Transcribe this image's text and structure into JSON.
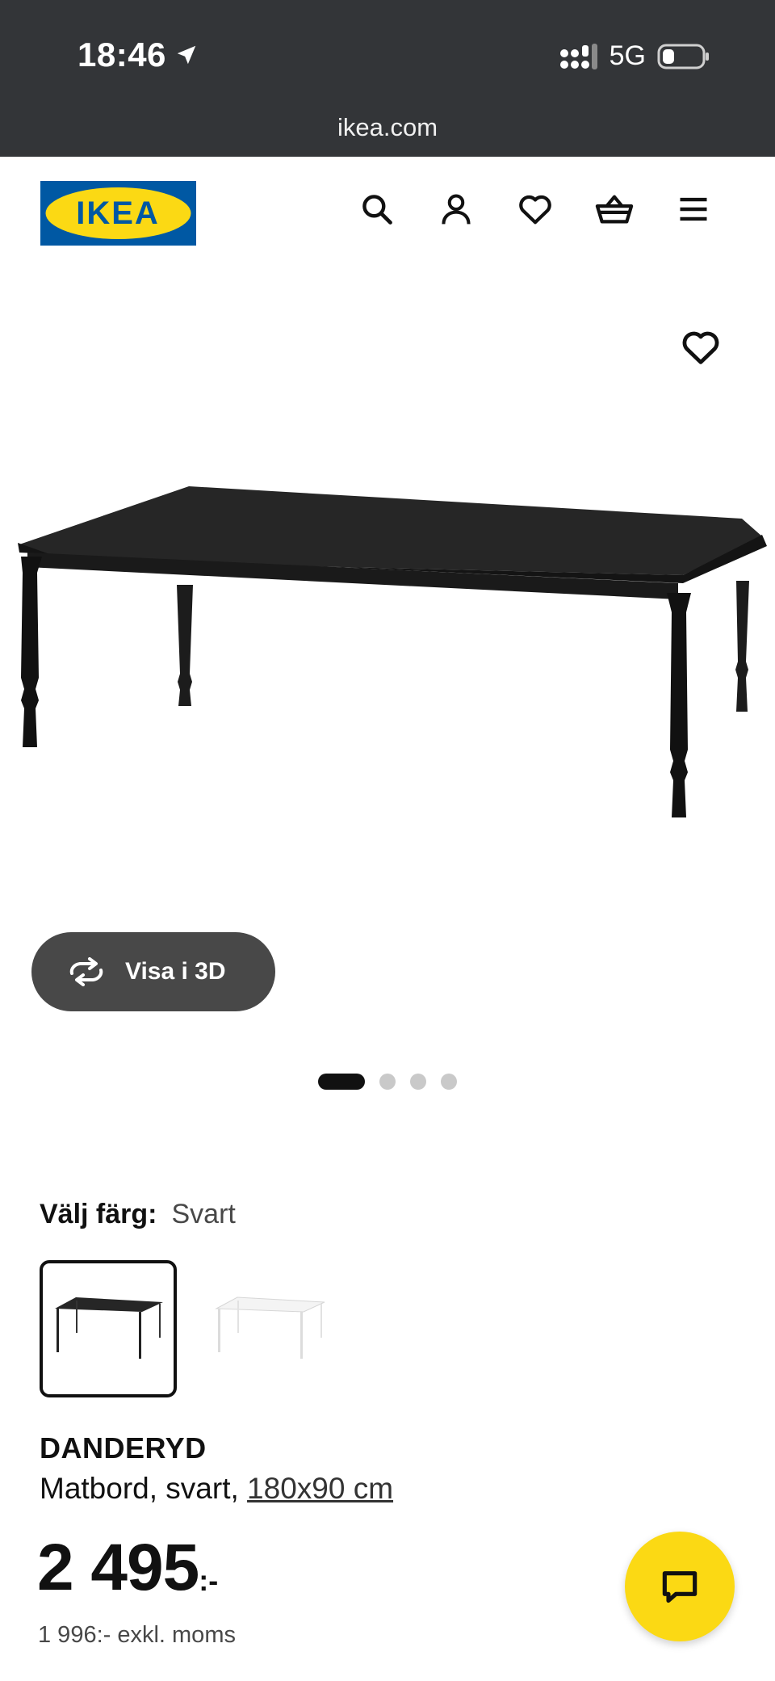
{
  "status_bar": {
    "time": "18:46",
    "network": "5G",
    "url": "ikea.com"
  },
  "header": {
    "logo_text": "IKEA",
    "icons": [
      "search-icon",
      "profile-icon",
      "heart-icon",
      "basket-icon",
      "menu-icon"
    ]
  },
  "gallery": {
    "view_3d_label": "Visa i 3D",
    "slide_count": 4,
    "active_slide": 1
  },
  "color_choice": {
    "label": "Välj färg:",
    "selected": "Svart",
    "options": [
      "Svart",
      "Vit"
    ]
  },
  "product": {
    "name": "DANDERYD",
    "description": "Matbord, svart,",
    "size": "180x90 cm",
    "price": "2 495",
    "price_suffix": ":-",
    "price_ex_vat": "1 996:- exkl. moms"
  },
  "colors": {
    "status_bar_bg": "#333538",
    "ikea_blue": "#0058a3",
    "ikea_yellow": "#fbd914",
    "button_dark": "#484848"
  }
}
